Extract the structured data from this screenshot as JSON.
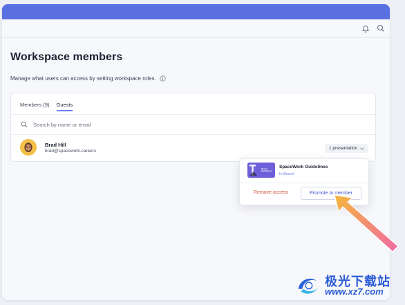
{
  "page": {
    "title": "Workspace members",
    "subtitle": "Manage what users can access by setting workspace roles."
  },
  "colors": {
    "header_bar": "#5a6fe0",
    "accent": "#6a7ff0",
    "danger": "#d0553a",
    "arrow_from": "#f5b63b",
    "arrow_to": "#f06aa6"
  },
  "toolbar": {
    "icons": [
      "bell-icon",
      "search-icon"
    ]
  },
  "tabs": [
    {
      "label": "Members (9)",
      "active": false
    },
    {
      "label": "Guests",
      "active": true
    }
  ],
  "search": {
    "placeholder": "Search by name or email"
  },
  "guest": {
    "name": "Brad Hill",
    "email": "brad@spacework.careers",
    "presentations_label": "1 presentation"
  },
  "popover": {
    "thumb_text": "Brand Guidelines",
    "presentation_title": "SpaceWork Guidelines",
    "presentation_location": "In Brand",
    "remove_label": "Remove access",
    "promote_label": "Promote to member"
  },
  "watermark": {
    "title": "极光下载站",
    "url": "www.xz7.com"
  }
}
